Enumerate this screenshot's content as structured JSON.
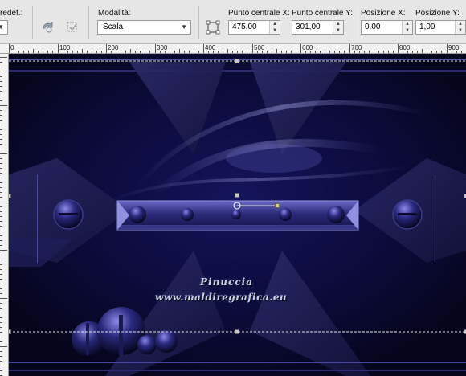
{
  "toolbar": {
    "preset_label": "redef.:",
    "mode_label": "Modalità:",
    "mode_value": "Scala",
    "center_x_label": "Punto centrale X:",
    "center_x_value": "475,00",
    "center_y_label": "Punto centrale Y:",
    "center_y_value": "301,00",
    "pos_x_label": "Posizione X:",
    "pos_x_value": "0,00",
    "pos_y_label": "Posizione Y:",
    "pos_y_value": "1,00"
  },
  "ruler": {
    "top_labels": [
      "0",
      "100",
      "200",
      "300",
      "400",
      "500",
      "600",
      "700",
      "800",
      "900"
    ]
  },
  "canvas": {
    "watermark_line1": "Pinuccia",
    "watermark_line2": "www.maldiregrafica.eu"
  },
  "colors": {
    "canvas_bg": "#0a0a33",
    "accent": "#5a5ab4"
  }
}
